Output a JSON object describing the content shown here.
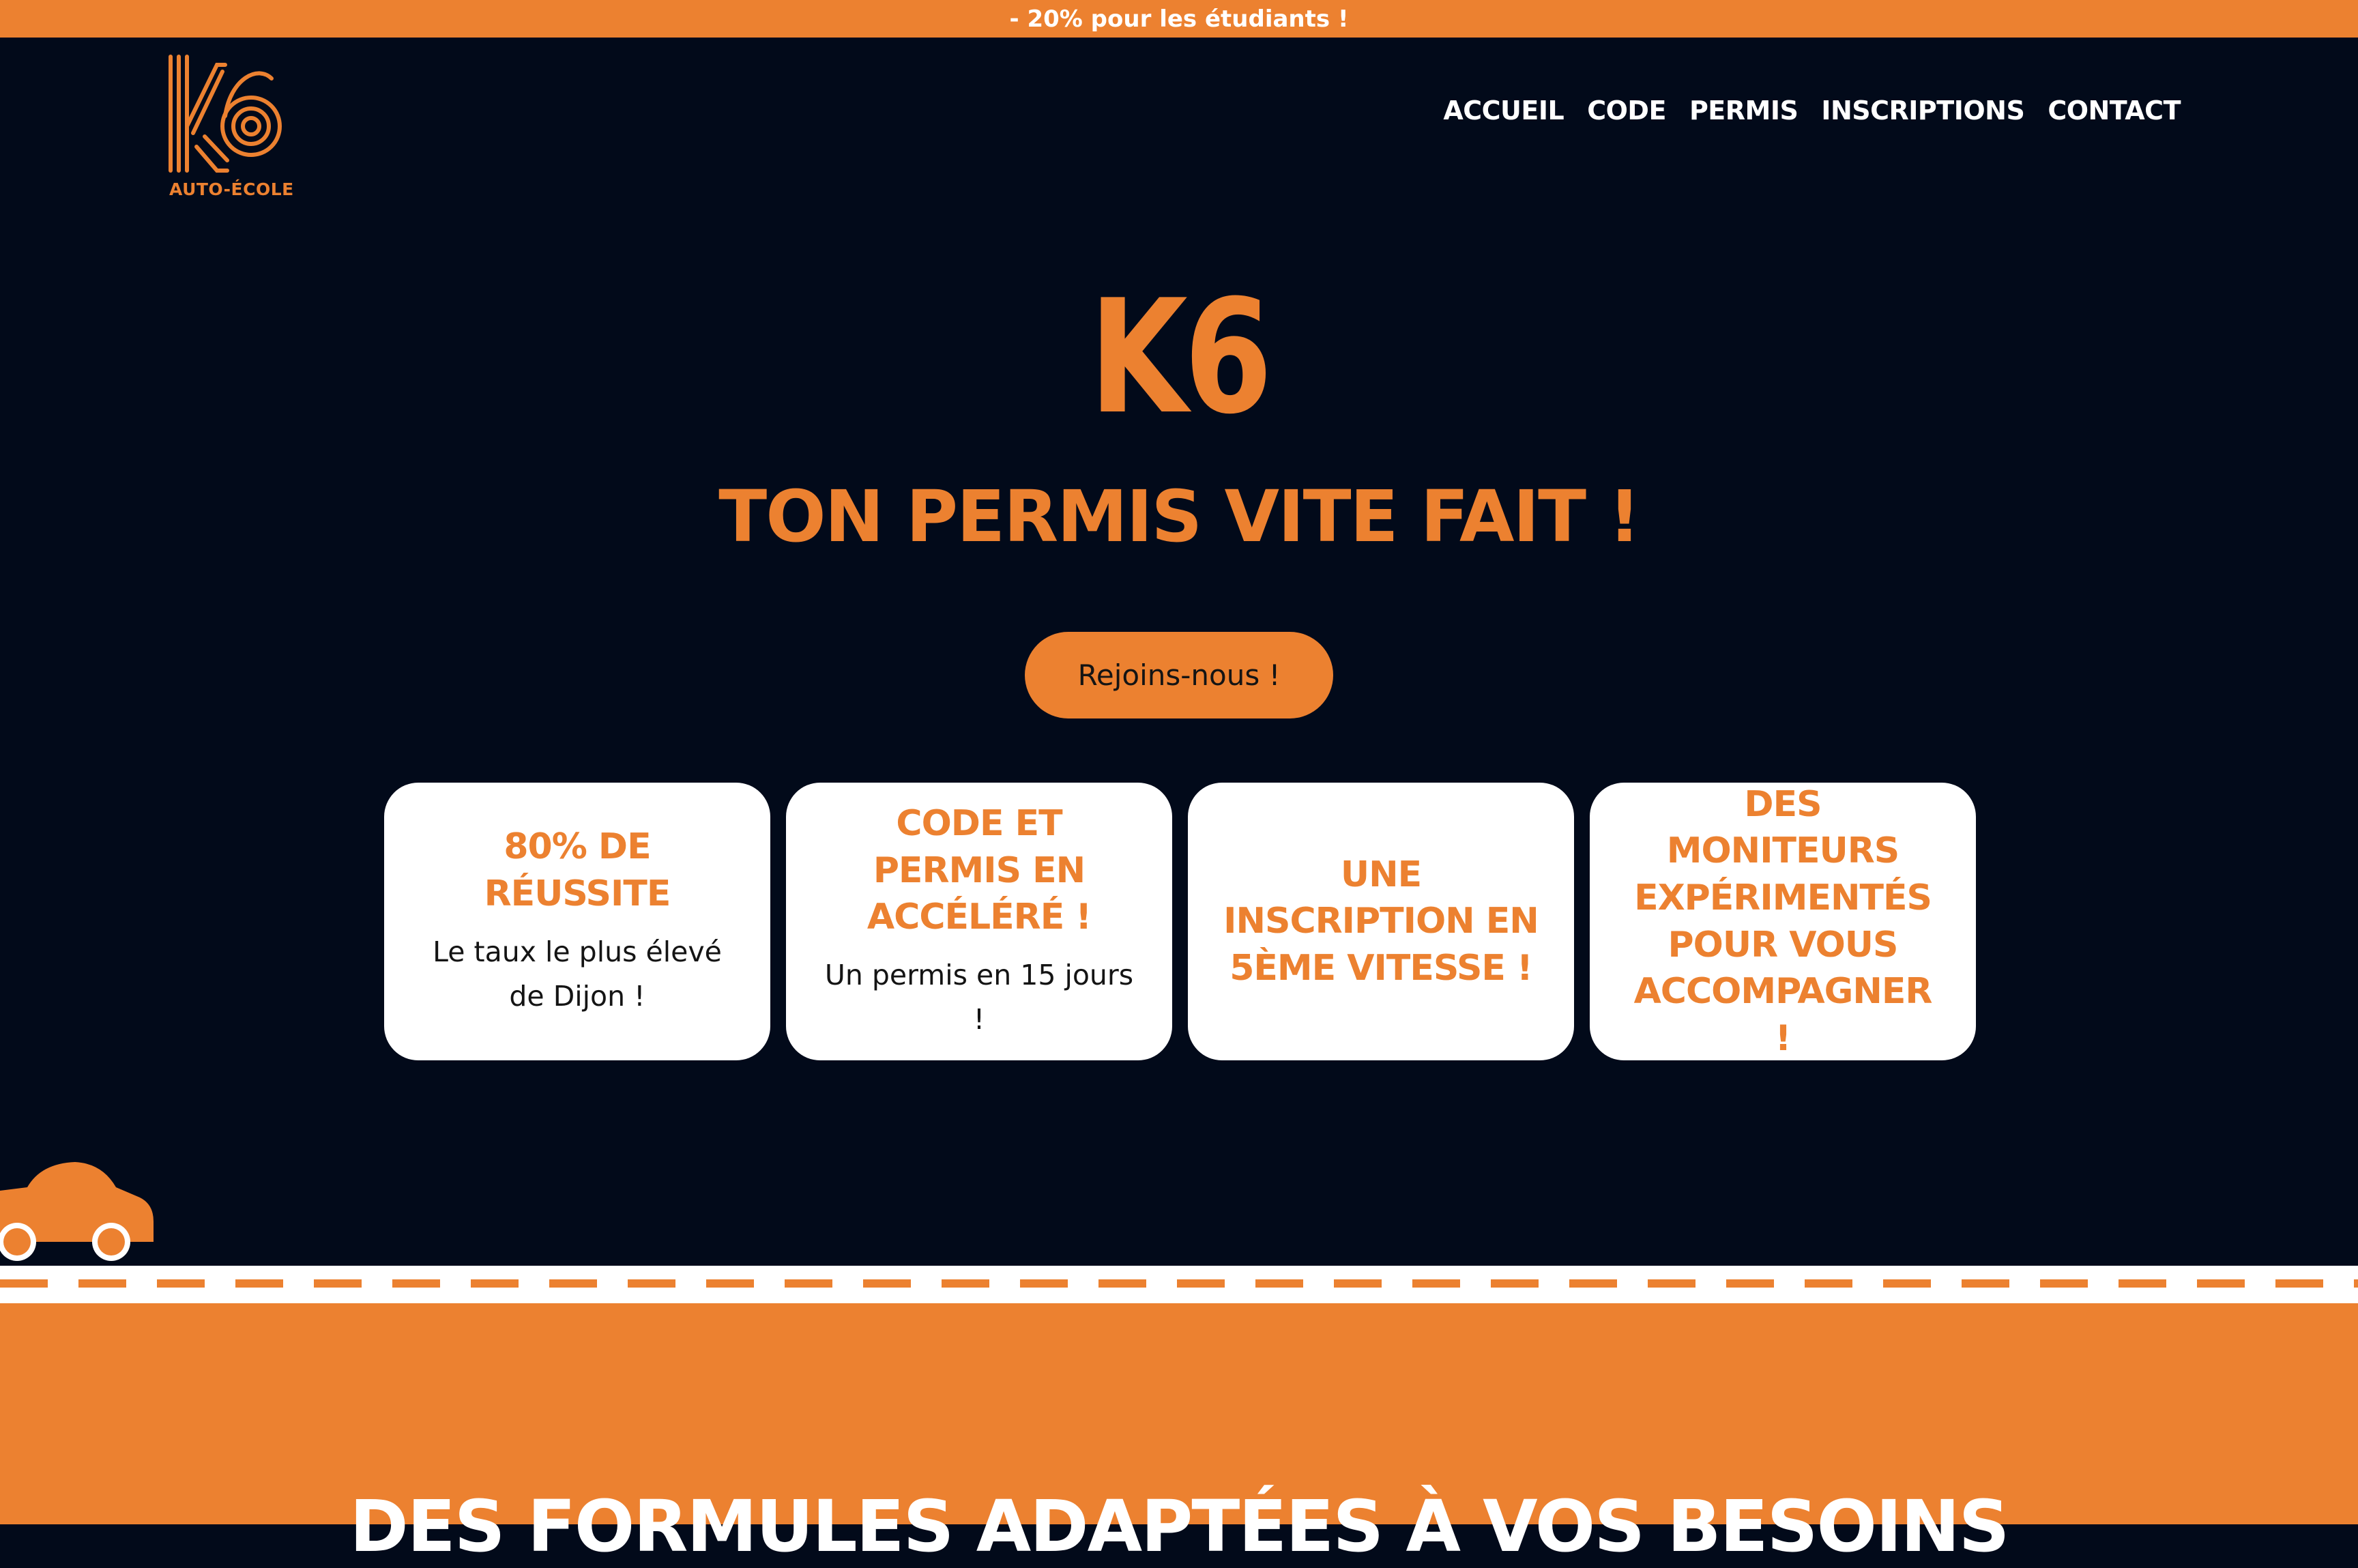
{
  "promo": {
    "text": "- 20% pour les étudiants !"
  },
  "header": {
    "logo_icon": "k6-logo-icon",
    "logo_subtitle": "AUTO-ÉCOLE",
    "nav": [
      {
        "label": "ACCUEIL"
      },
      {
        "label": "CODE"
      },
      {
        "label": "PERMIS"
      },
      {
        "label": "INSCRIPTIONS"
      },
      {
        "label": "CONTACT"
      }
    ]
  },
  "hero": {
    "title": "K6",
    "subtitle": "TON PERMIS VITE FAIT !",
    "cta_label": "Rejoins-nous !"
  },
  "cards": [
    {
      "title": "80% DE RÉUSSITE",
      "text": "Le taux le plus élevé de Dijon !"
    },
    {
      "title": "CODE ET PERMIS EN ACCÉLÉRÉ !",
      "text": "Un permis en 15 jours !"
    },
    {
      "title": "UNE INSCRIPTION EN 5ÈME VITESSE !",
      "text": ""
    },
    {
      "title": "DES MONITEURS EXPÉRIMENTÉS POUR VOUS ACCOMPAGNER !",
      "text": ""
    }
  ],
  "decor": {
    "car_icon": "car-icon"
  },
  "section": {
    "heading": "DES FORMULES ADAPTÉES À VOS BESOINS"
  },
  "colors": {
    "accent": "#ec8130",
    "background": "#020a1a",
    "card_background": "#ffffff",
    "text_dark": "#141414"
  }
}
